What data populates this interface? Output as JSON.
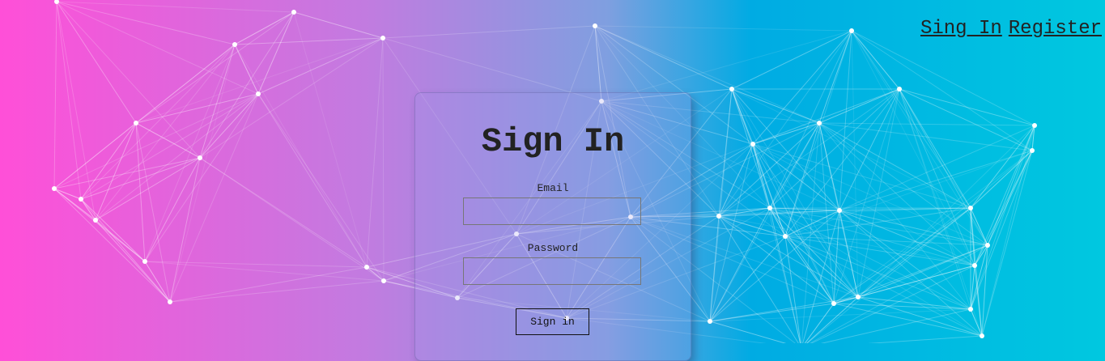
{
  "nav": {
    "sign_in": "Sing In",
    "register": "Register"
  },
  "form": {
    "title": "Sign In",
    "email_label": "Email",
    "email_value": "",
    "password_label": "Password",
    "password_value": "",
    "submit_label": "Sign in"
  },
  "colors": {
    "gradient": [
      "#ff4fd8",
      "#c27be0",
      "#7f9fe0",
      "#00abe3",
      "#00c8e0"
    ],
    "network": "#ffffff",
    "text": "#222222"
  }
}
